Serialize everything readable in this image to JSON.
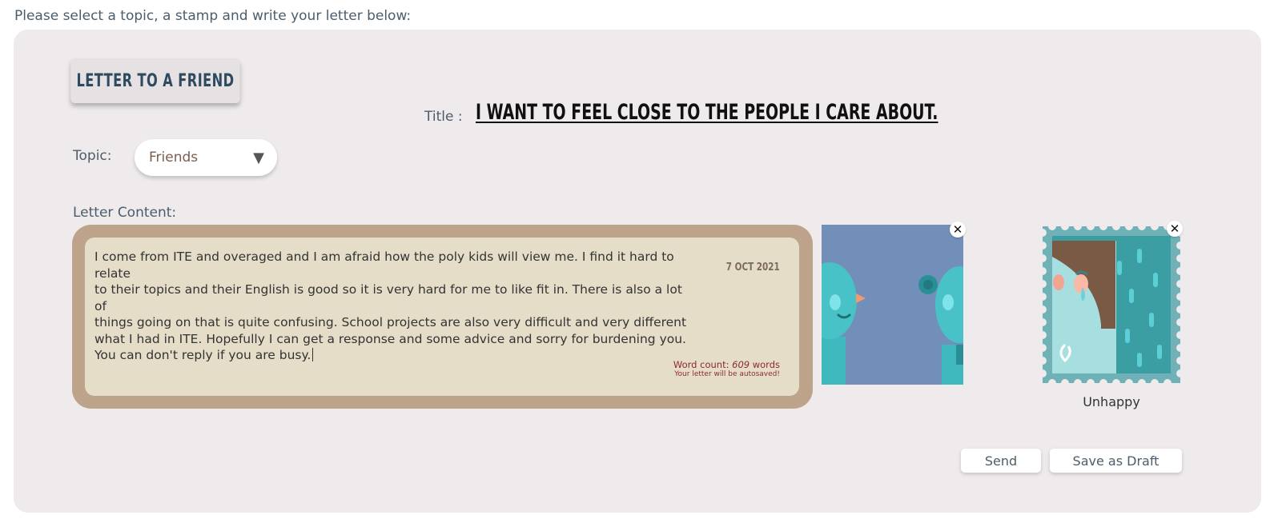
{
  "instructions": "Please select a topic, a stamp and write your letter below:",
  "letter_type": "LETTER TO A FRIEND",
  "title": {
    "label": "Title :",
    "value": "I WANT TO FEEL CLOSE TO THE PEOPLE I CARE ABOUT."
  },
  "topic": {
    "label": "Topic:",
    "selected": "Friends",
    "arrow": "▼"
  },
  "letter": {
    "label": "Letter Content:",
    "lines": [
      "I come from ITE and overaged and I am afraid how the poly kids will view me. I find it hard to relate",
      "to their topics and their English is good so it is very hard for me to like fit in. There is also a lot of",
      "things going on that is quite confusing. School projects are also very difficult and very different",
      "what I had in ITE. Hopefully I can get a response and some advice and sorry for burdening you.",
      "You can don't reply if you are busy."
    ],
    "date": "7 OCT 2021",
    "word_count_prefix": "Word count: ",
    "word_count": "609",
    "word_count_suffix": " words",
    "autosave_note": "Your letter will be autosaved!"
  },
  "stamp": {
    "label": "Unhappy"
  },
  "close_symbol": "✕",
  "buttons": {
    "send": "Send",
    "save_draft": "Save as Draft"
  },
  "colors": {
    "panel_bg": "#efebec",
    "letter_frame": "#bca38a",
    "letter_paper": "#e6ddc9",
    "topic_card_bg": "#728fba",
    "stamp_teal": "#3a9ea3",
    "text_accent": "#4b5d6c"
  }
}
